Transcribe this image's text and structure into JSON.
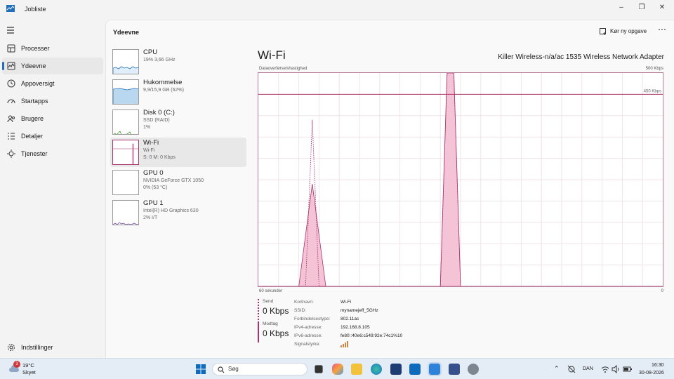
{
  "window": {
    "title": "Jobliste",
    "minimize": "‒",
    "maximize": "❐",
    "close": "✕"
  },
  "sidebar": {
    "items": [
      {
        "label": "Processer"
      },
      {
        "label": "Ydeevne"
      },
      {
        "label": "Appoversigt"
      },
      {
        "label": "Startapps"
      },
      {
        "label": "Brugere"
      },
      {
        "label": "Detaljer"
      },
      {
        "label": "Tjenester"
      }
    ],
    "settings": "Indstillinger"
  },
  "header": {
    "title": "Ydeevne",
    "run_task": "Kør ny opgave",
    "more": "⋯"
  },
  "devices": [
    {
      "name": "CPU",
      "line1": "19% 3,66 GHz",
      "line2": ""
    },
    {
      "name": "Hukommelse",
      "line1": "9,9/15,9 GB (62%)",
      "line2": ""
    },
    {
      "name": "Disk 0 (C:)",
      "line1": "SSD (RAID)",
      "line2": "1%"
    },
    {
      "name": "Wi-Fi",
      "line1": "Wi-Fi",
      "line2": "S: 0 M: 0 Kbps"
    },
    {
      "name": "GPU 0",
      "line1": "NVIDIA GeForce GTX 1050",
      "line2": "0% (53 °C)"
    },
    {
      "name": "GPU 1",
      "line1": "Intel(R) HD Graphics 630",
      "line2": "2% I/T"
    }
  ],
  "detail": {
    "title": "Wi-Fi",
    "adapter": "Killer Wireless-n/a/ac 1535 Wireless Network Adapter",
    "graph_label": "Dataoverførselshastighed",
    "graph_max": "500 Kbps",
    "graph_line_label": "450 Kbps",
    "x_left": "60 sekunder",
    "x_right": "0",
    "send_label": "Send",
    "send_value": "0 Kbps",
    "recv_label": "Modtag",
    "recv_value": "0 Kbps",
    "props": [
      {
        "k": "Kortnavn:",
        "v": "Wi-Fi"
      },
      {
        "k": "SSID:",
        "v": "mynamejeff_5GHz"
      },
      {
        "k": "Forbindelsestype:",
        "v": "802.11ac"
      },
      {
        "k": "IPv4-adresse:",
        "v": "192.168.8.105"
      },
      {
        "k": "IPv6-adresse:",
        "v": "fe80::40e6:c549:92e:74c1%10"
      },
      {
        "k": "Signalstyrke:",
        "v": ""
      }
    ]
  },
  "chart_data": {
    "type": "area",
    "x_unit": "seconds ago",
    "ylim": [
      0,
      500
    ],
    "scale_line": 450,
    "series": [
      {
        "values": [
          [
            60,
            0
          ],
          [
            53,
            0
          ],
          [
            52,
            390
          ],
          [
            51,
            0
          ],
          [
            33,
            0
          ],
          [
            32,
            500
          ],
          [
            31,
            500
          ],
          [
            30,
            0
          ],
          [
            0,
            0
          ]
        ]
      },
      {
        "values": [
          [
            60,
            0
          ],
          [
            54,
            0
          ],
          [
            52,
            240
          ],
          [
            50,
            0
          ],
          [
            33,
            0
          ],
          [
            32,
            500
          ],
          [
            31,
            500
          ],
          [
            30,
            0
          ],
          [
            0,
            0
          ]
        ]
      }
    ]
  },
  "taskbar": {
    "temp": "19°C",
    "cond": "Skyet",
    "badge": "3",
    "search": "Søg",
    "lang": "DAN",
    "time": "16:30",
    "date": "30-08-2026"
  },
  "colors": {
    "accent": "#1f6fbd",
    "wifi": "#a8336e",
    "wifi_fill": "#f4c4d6"
  }
}
